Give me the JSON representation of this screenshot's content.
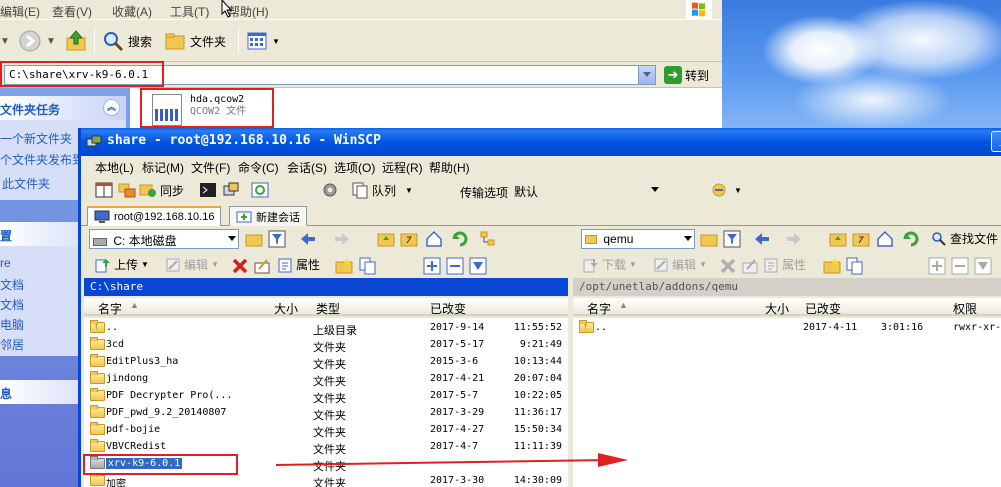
{
  "explorer": {
    "menu": [
      "编辑(E)",
      "查看(V)",
      "收藏(A)",
      "工具(T)",
      "帮助(H)"
    ],
    "toolbar": {
      "search_label": "搜索",
      "folders_label": "文件夹"
    },
    "address": {
      "value": "C:\\share\\xrv-k9-6.0.1",
      "go_label": "转到"
    },
    "sidebar": {
      "folder_tasks_title": "文件夹任务",
      "task_links": [
        "一个新文件夹",
        "个文件夹发布到",
        "此文件夹"
      ],
      "places_title": "置",
      "places_links": [
        "re",
        "文档",
        "文档",
        "电脑",
        "邻居"
      ],
      "details_title": "息"
    },
    "file": {
      "name": "hda.qcow2",
      "type": "QCOW2 文件"
    }
  },
  "winscp": {
    "title": "share - root@192.168.10.16 - WinSCP",
    "menu": [
      "本地(L)",
      "标记(M)",
      "文件(F)",
      "命令(C)",
      "会话(S)",
      "选项(O)",
      "远程(R)",
      "帮助(H)"
    ],
    "toolbar": {
      "sync_label": "同步",
      "queue_label": "队列",
      "transfer_options_label": "传输选项",
      "transfer_options_value": "默认"
    },
    "tabs": {
      "session": "root@192.168.10.16",
      "new_session": "新建会话"
    },
    "local": {
      "drive": "C: 本地磁盘",
      "upload_label": "上传",
      "edit_label": "编辑",
      "properties_label": "属性",
      "path": "C:\\share",
      "columns": {
        "name": "名字",
        "size": "大小",
        "type": "类型",
        "modified": "已改变"
      },
      "files": [
        {
          "name": "..",
          "type": "上级目录",
          "date": "2017-9-14",
          "time": "11:55:52",
          "kind": "up"
        },
        {
          "name": "3cd",
          "type": "文件夹",
          "date": "2017-5-17",
          "time": "9:21:49",
          "kind": "folder"
        },
        {
          "name": "EditPlus3_ha",
          "type": "文件夹",
          "date": "2015-3-6",
          "time": "10:13:44",
          "kind": "folder"
        },
        {
          "name": "jindong",
          "type": "文件夹",
          "date": "2017-4-21",
          "time": "20:07:04",
          "kind": "folder"
        },
        {
          "name": "PDF Decrypter Pro(...",
          "type": "文件夹",
          "date": "2017-5-7",
          "time": "10:22:05",
          "kind": "folder"
        },
        {
          "name": "PDF_pwd_9.2_20140807",
          "type": "文件夹",
          "date": "2017-3-29",
          "time": "11:36:17",
          "kind": "folder"
        },
        {
          "name": "pdf-bojie",
          "type": "文件夹",
          "date": "2017-4-27",
          "time": "15:50:34",
          "kind": "folder"
        },
        {
          "name": "VBVCRedist",
          "type": "文件夹",
          "date": "2017-4-7",
          "time": "11:11:39",
          "kind": "folder"
        },
        {
          "name": "xrv-k9-6.0.1",
          "type": "文件夹",
          "date": "",
          "time": "",
          "kind": "grey"
        },
        {
          "name": "加密",
          "type": "文件夹",
          "date": "2017-3-30",
          "time": "14:30:09",
          "kind": "folder"
        }
      ]
    },
    "remote": {
      "folder": "qemu",
      "download_label": "下载",
      "edit_label": "编辑",
      "properties_label": "属性",
      "find_label": "查找文件",
      "path": "/opt/unetlab/addons/qemu",
      "columns": {
        "name": "名字",
        "size": "大小",
        "modified": "已改变",
        "permissions": "权限"
      },
      "files": [
        {
          "name": "..",
          "date": "2017-4-11",
          "time": "3:01:16",
          "perm": "rwxr-xr-x"
        }
      ]
    }
  }
}
